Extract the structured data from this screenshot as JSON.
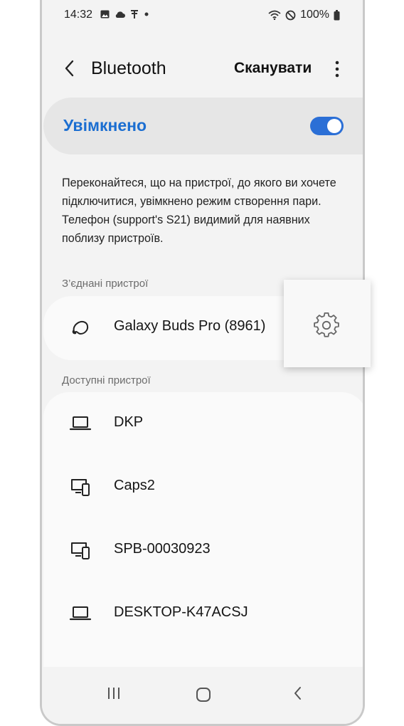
{
  "status_bar": {
    "time": "14:32",
    "battery": "100%",
    "left_icons": [
      "image-icon",
      "cloud-icon",
      "usb-icon",
      "dot-icon"
    ],
    "right_icons": [
      "wifi-icon",
      "do-not-disturb-icon",
      "battery-icon"
    ]
  },
  "app_bar": {
    "title": "Bluetooth",
    "scan_label": "Сканувати"
  },
  "master_toggle": {
    "label": "Увімкнено",
    "on": true,
    "accent": "#1b6ed1"
  },
  "description": "Переконайтеся, що на пристрої, до якого ви хочете підключитися, увімкнено режим створення пари. Телефон (support's S21) видимий для наявних поблизу пристроїв.",
  "paired": {
    "header": "З’єднані пристрої",
    "devices": [
      {
        "name": "Galaxy Buds Pro (8961)",
        "icon": "earbuds-icon"
      }
    ]
  },
  "available": {
    "header": "Доступні пристрої",
    "devices": [
      {
        "name": "DKP",
        "icon": "laptop-icon"
      },
      {
        "name": "Caps2",
        "icon": "monitor-phone-icon"
      },
      {
        "name": "SPB-00030923",
        "icon": "monitor-phone-icon"
      },
      {
        "name": "DESKTOP-K47ACSJ",
        "icon": "laptop-icon"
      }
    ]
  },
  "nav_bar": {
    "buttons": [
      "recent-apps",
      "home",
      "back"
    ]
  }
}
